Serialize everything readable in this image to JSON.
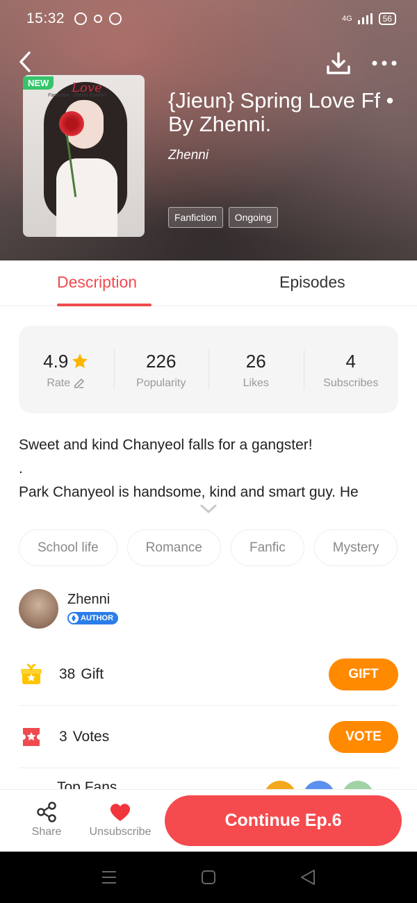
{
  "status_bar": {
    "time": "15:32",
    "network": "4G",
    "battery": "56"
  },
  "book": {
    "badge": "NEW",
    "title": "{Jieun} Spring Love Ff • By Zhenni.",
    "author": "Zhenni",
    "cover_text": "Love",
    "cover_subtext": "Fanfiction · Zhenni Eun/NJ",
    "tags": [
      "Fanfiction",
      "Ongoing"
    ]
  },
  "tabs": [
    "Description",
    "Episodes"
  ],
  "stats": [
    {
      "value": "4.9",
      "label": "Rate"
    },
    {
      "value": "226",
      "label": "Popularity"
    },
    {
      "value": "26",
      "label": "Likes"
    },
    {
      "value": "4",
      "label": "Subscribes"
    }
  ],
  "description": {
    "line1": "Sweet and kind Chanyeol falls for a gangster!",
    "line2": ".",
    "line3": "Park Chanyeol is handsome, kind and smart guy. He"
  },
  "genres": [
    "School life",
    "Romance",
    "Fanfic",
    "Mystery"
  ],
  "author_section": {
    "name": "Zhenni",
    "badge": "AUTHOR"
  },
  "gift": {
    "count": "38",
    "label": "Gift",
    "button": "GIFT"
  },
  "vote": {
    "count": "3",
    "label": "Votes",
    "button": "VOTE"
  },
  "top_fans": {
    "label": "Top Fans"
  },
  "bottom_bar": {
    "share": "Share",
    "unsubscribe": "Unsubscribe",
    "continue": "Continue Ep.6"
  },
  "colors": {
    "accent": "#f04a4f",
    "orange": "#ff8a00",
    "badge_green": "#36c46b",
    "author_blue": "#2b7de9"
  }
}
